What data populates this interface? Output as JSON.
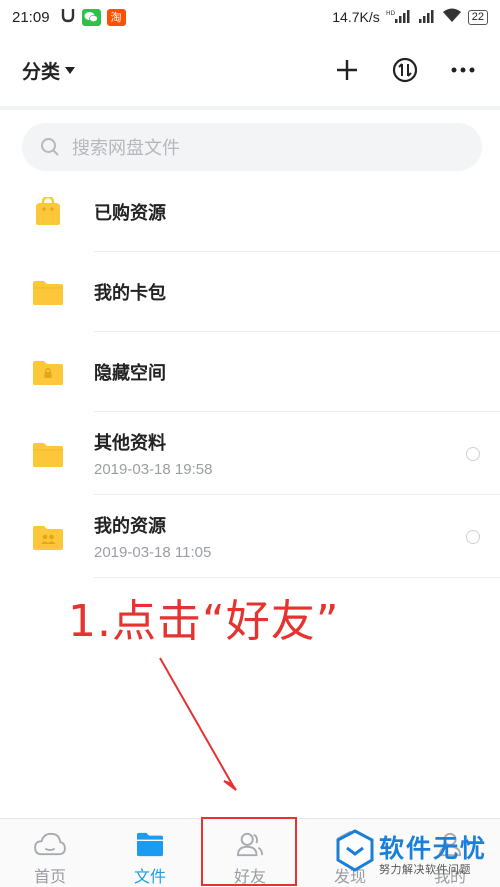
{
  "status_bar": {
    "time": "21:09",
    "network_speed": "14.7K/s",
    "network_type": "HD",
    "battery": "22",
    "icons": [
      "notification-icon",
      "wechat-icon",
      "taobao-icon",
      "signal-icon",
      "wifi-icon",
      "battery-icon"
    ]
  },
  "header": {
    "category_label": "分类",
    "actions": [
      "add-icon",
      "sort-icon",
      "more-icon"
    ]
  },
  "search": {
    "placeholder": "搜索网盘文件"
  },
  "files": [
    {
      "name": "已购资源",
      "date": "",
      "icon": "purchased-bag-icon"
    },
    {
      "name": "我的卡包",
      "date": "",
      "icon": "folder-icon"
    },
    {
      "name": "隐藏空间",
      "date": "",
      "icon": "locked-folder-icon"
    },
    {
      "name": "其他资料",
      "date": "2019-03-18  19:58",
      "icon": "folder-icon"
    },
    {
      "name": "我的资源",
      "date": "2019-03-18  11:05",
      "icon": "shared-folder-icon"
    }
  ],
  "annotation": {
    "text": "1.点击“好友”"
  },
  "bottom_nav": [
    {
      "label": "首页",
      "icon": "home-cloud-icon",
      "active": false
    },
    {
      "label": "文件",
      "icon": "file-folder-icon",
      "active": true
    },
    {
      "label": "好友",
      "icon": "friends-icon",
      "active": false
    },
    {
      "label": "发现",
      "icon": "discover-icon",
      "active": false
    },
    {
      "label": "我的",
      "icon": "profile-icon",
      "active": false
    }
  ],
  "watermark": {
    "title": "软件无忧",
    "subtitle": "努力解决软件问题"
  },
  "colors": {
    "accent": "#1a9cf0",
    "folder": "#fdc73a",
    "annotation": "#e53330"
  }
}
